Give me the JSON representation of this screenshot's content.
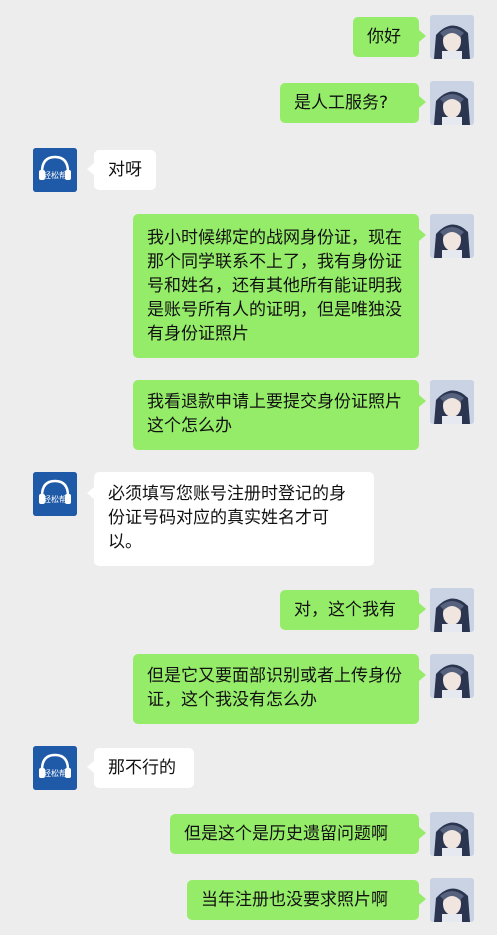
{
  "colors": {
    "background": "#ededed",
    "user_bubble": "#95ec69",
    "agent_bubble": "#ffffff",
    "agent_avatar": "#1f5aa8"
  },
  "agent": {
    "avatar_text": "轻松帮"
  },
  "messages": [
    {
      "from": "user",
      "text": "你好"
    },
    {
      "from": "user",
      "text": "是人工服务?"
    },
    {
      "from": "agent",
      "text": "对呀"
    },
    {
      "from": "user",
      "text": "我小时候绑定的战网身份证，现在那个同学联系不上了，我有身份证号和姓名，还有其他所有能证明我是账号所有人的证明，但是唯独没有身份证照片"
    },
    {
      "from": "user",
      "text": "我看退款申请上要提交身份证照片这个怎么办"
    },
    {
      "from": "agent",
      "text": "必须填写您账号注册时登记的身份证号码对应的真实姓名才可以。"
    },
    {
      "from": "user",
      "text": "对，这个我有"
    },
    {
      "from": "user",
      "text": "但是它又要面部识别或者上传身份证，这个我没有怎么办"
    },
    {
      "from": "agent",
      "text": "那不行的"
    },
    {
      "from": "user",
      "text": "但是这个是历史遗留问题啊"
    },
    {
      "from": "user",
      "text": "当年注册也没要求照片啊"
    }
  ]
}
